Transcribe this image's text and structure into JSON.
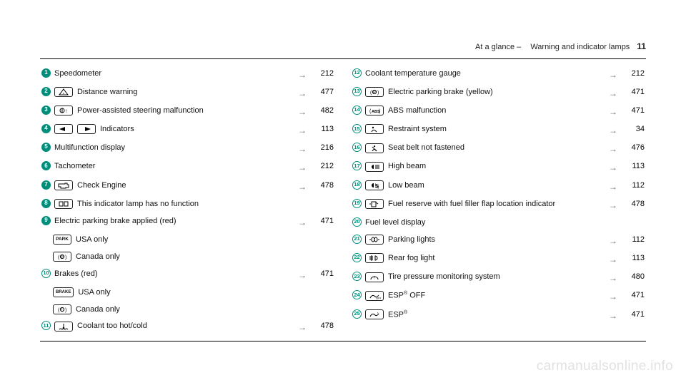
{
  "header": {
    "section_prefix": "At a glance – ",
    "section": "Warning and indicator lamps",
    "page": "11"
  },
  "watermark": "carmanualsonline.info",
  "left": [
    {
      "n": "1",
      "style": "solid",
      "icons": [],
      "text": "Speedometer",
      "page": "212"
    },
    {
      "n": "2",
      "style": "solid",
      "icons": [
        "distance-warning-icon"
      ],
      "text": "Distance warning",
      "page": "477"
    },
    {
      "n": "3",
      "style": "solid",
      "icons": [
        "power-steering-icon"
      ],
      "text": "Power-assisted steering malfunction",
      "page": "482"
    },
    {
      "n": "4",
      "style": "solid",
      "icons": [
        "turn-left-icon",
        "turn-right-icon"
      ],
      "text": "Indicators",
      "page": "113"
    },
    {
      "n": "5",
      "style": "solid",
      "icons": [],
      "text": "Multifunction display",
      "page": "216"
    },
    {
      "n": "6",
      "style": "solid",
      "icons": [],
      "text": "Tachometer",
      "page": "212"
    },
    {
      "n": "7",
      "style": "solid",
      "icons": [
        "check-engine-icon"
      ],
      "text": "Check Engine",
      "page": "478"
    },
    {
      "n": "8",
      "style": "solid",
      "icons": [
        "blank-icon"
      ],
      "text": "This indicator lamp has no function",
      "page": ""
    },
    {
      "n": "9",
      "style": "solid",
      "icons": [],
      "text": "Electric parking brake applied (red)",
      "page": "471"
    },
    {
      "n": "",
      "style": "",
      "icons": [
        "park-usa-icon"
      ],
      "text": "USA only",
      "page": "",
      "sub": true
    },
    {
      "n": "",
      "style": "",
      "icons": [
        "park-canada-icon"
      ],
      "text": "Canada only",
      "page": "",
      "sub": true
    },
    {
      "n": "10",
      "style": "outline",
      "icons": [],
      "text": "Brakes (red)",
      "page": "471"
    },
    {
      "n": "",
      "style": "",
      "icons": [
        "brake-usa-icon"
      ],
      "text": "USA only",
      "page": "",
      "sub": true
    },
    {
      "n": "",
      "style": "",
      "icons": [
        "brake-canada-icon"
      ],
      "text": "Canada only",
      "page": "",
      "sub": true
    },
    {
      "n": "11",
      "style": "outline",
      "icons": [
        "coolant-temp-icon"
      ],
      "text": "Coolant too hot/cold",
      "page": "478"
    }
  ],
  "right": [
    {
      "n": "12",
      "style": "outline",
      "icons": [],
      "text": "Coolant temperature gauge",
      "page": "212"
    },
    {
      "n": "13",
      "style": "outline",
      "icons": [
        "park-canada-icon"
      ],
      "text": "Electric parking brake (yellow)",
      "page": "471"
    },
    {
      "n": "14",
      "style": "outline",
      "icons": [
        "abs-icon"
      ],
      "text": "ABS malfunction",
      "page": "471"
    },
    {
      "n": "15",
      "style": "outline",
      "icons": [
        "restraint-icon"
      ],
      "text": "Restraint system",
      "page": "34"
    },
    {
      "n": "16",
      "style": "outline",
      "icons": [
        "seatbelt-icon"
      ],
      "text": "Seat belt not fastened",
      "page": "476"
    },
    {
      "n": "17",
      "style": "outline",
      "icons": [
        "high-beam-icon"
      ],
      "text": "High beam",
      "page": "113"
    },
    {
      "n": "18",
      "style": "outline",
      "icons": [
        "low-beam-icon"
      ],
      "text": "Low beam",
      "page": "112"
    },
    {
      "n": "19",
      "style": "outline",
      "icons": [
        "fuel-reserve-icon"
      ],
      "html": "Fuel reserve with fuel filler flap location indicator",
      "page": "478"
    },
    {
      "n": "20",
      "style": "outline",
      "icons": [],
      "text": "Fuel level display",
      "page": ""
    },
    {
      "n": "21",
      "style": "outline",
      "icons": [
        "parking-lights-icon"
      ],
      "text": "Parking lights",
      "page": "112"
    },
    {
      "n": "22",
      "style": "outline",
      "icons": [
        "rear-fog-icon"
      ],
      "text": "Rear fog light",
      "page": "113"
    },
    {
      "n": "23",
      "style": "outline",
      "icons": [
        "tpms-icon"
      ],
      "text": "Tire pressure monitoring system",
      "page": "480"
    },
    {
      "n": "24",
      "style": "outline",
      "icons": [
        "esp-off-icon"
      ],
      "html": "ESP<sup>®</sup> OFF",
      "page": "471"
    },
    {
      "n": "25",
      "style": "outline",
      "icons": [
        "esp-icon"
      ],
      "html": "ESP<sup>®</sup>",
      "page": "471"
    }
  ],
  "arrow": "→"
}
